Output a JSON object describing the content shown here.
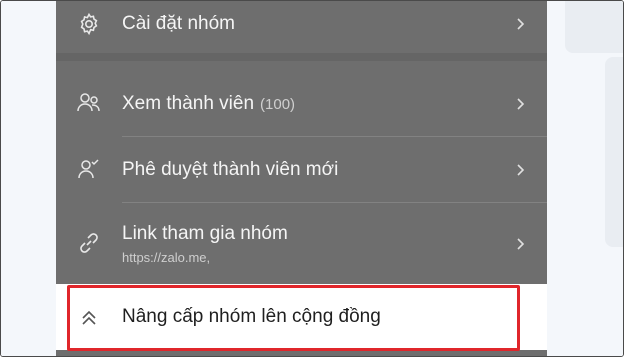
{
  "menu": {
    "settings": {
      "label": "Cài đặt nhóm"
    },
    "members": {
      "label": "Xem thành viên",
      "count": "(100)"
    },
    "approve": {
      "label": "Phê duyệt thành viên mới"
    },
    "link": {
      "label": "Link tham gia nhóm",
      "url": "https://zalo.me,"
    },
    "upgrade": {
      "label": "Nâng cấp nhóm lên cộng đồng"
    }
  },
  "colors": {
    "overlay": "#6e6e6e",
    "highlight_border": "#e0262b",
    "highlight_bg": "#ffffff"
  },
  "icons": {
    "settings": "gear-icon",
    "members": "people-icon",
    "approve": "person-check-icon",
    "link": "link-icon",
    "upgrade": "double-chevron-up-icon",
    "chevron": "chevron-right-icon"
  }
}
